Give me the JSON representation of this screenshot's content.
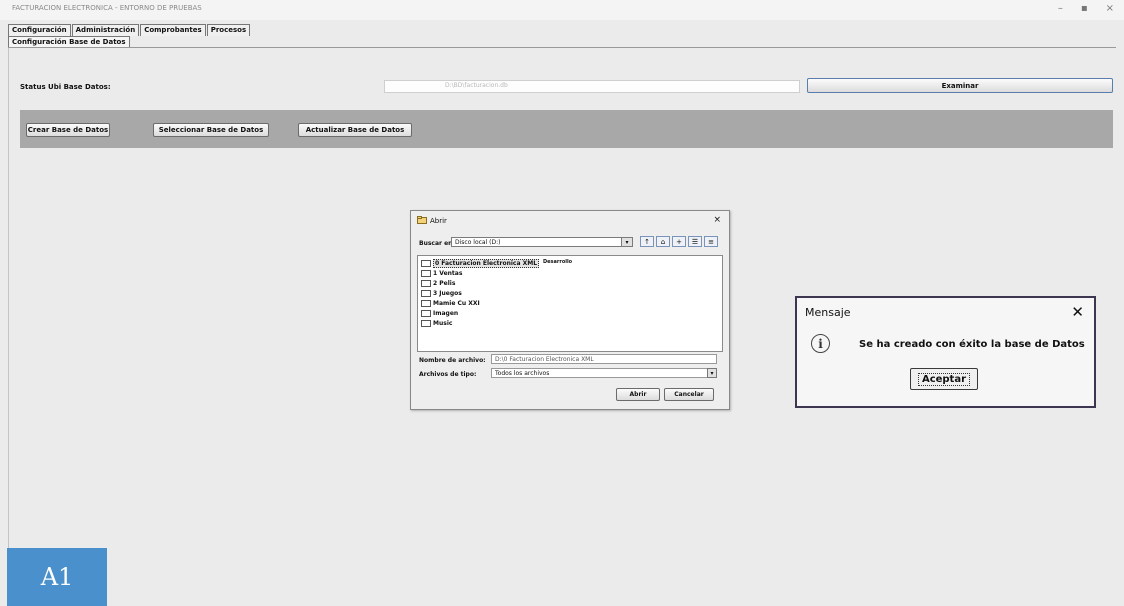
{
  "window": {
    "title": "FACTURACION ELECTRONICA - ENTORNO DE PRUEBAS",
    "controls": [
      "–",
      "▪",
      "×"
    ]
  },
  "menu": [
    "Configuración",
    "Administración",
    "Comprobantes",
    "Procesos"
  ],
  "subtab": "Configuración Base de Datos",
  "status": {
    "label": "Status Ubi Base Datos:",
    "field_value": "D:\\BD\\facturacion.db",
    "examinar_label": "Examinar"
  },
  "panel_buttons": {
    "crear": "Crear Base de Datos",
    "seleccionar": "Seleccionar Base de Datos",
    "actualizar": "Actualizar Base de Datos"
  },
  "file_dialog": {
    "title": "Abrir",
    "close": "×",
    "lookin_label": "Buscar en:",
    "lookin_value": "Disco local (D:)",
    "items": [
      "0 Facturacion Electronica XML",
      "1 Ventas",
      "2 Pelis",
      "3 Juegos",
      "Mamie Cu XXI",
      "Imagen",
      "Music"
    ],
    "selected_extra": "Desarrollo",
    "filename_label": "Nombre de archivo:",
    "filename_value": "D:\\0 Facturacion Electronica XML",
    "filetype_label": "Archivos de tipo:",
    "filetype_value": "Todos los archivos",
    "open_label": "Abrir",
    "cancel_label": "Cancelar"
  },
  "message_box": {
    "title": "Mensaje",
    "close": "✕",
    "icon": "info-icon",
    "text": "Se ha creado con éxito la base de Datos",
    "ok_label": "Aceptar"
  },
  "corner_badge": "A1",
  "colors": {
    "badge": "#4a90cc",
    "panel": "#a8a8a8",
    "dialog_border": "#3e3550"
  }
}
